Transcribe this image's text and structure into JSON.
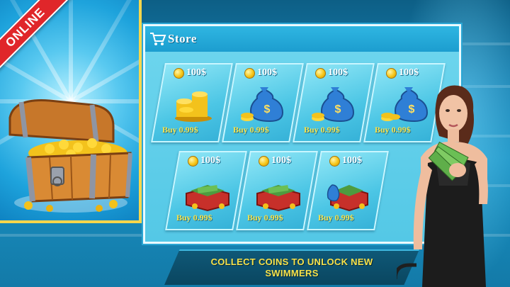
{
  "badge": {
    "label": "ONLINE"
  },
  "store": {
    "title": "Store",
    "items": [
      {
        "amount": "100$",
        "price": "Buy 0.99$",
        "art": "coin-stack"
      },
      {
        "amount": "100$",
        "price": "Buy 0.99$",
        "art": "money-bag"
      },
      {
        "amount": "100$",
        "price": "Buy 0.99$",
        "art": "money-bag"
      },
      {
        "amount": "100$",
        "price": "Buy 0.99$",
        "art": "money-bag"
      },
      {
        "amount": "100$",
        "price": "Buy 0.99$",
        "art": "cash-box"
      },
      {
        "amount": "100$",
        "price": "Buy 0.99$",
        "art": "cash-box"
      },
      {
        "amount": "100$",
        "price": "Buy 0.99$",
        "art": "cash-box-bag"
      }
    ]
  },
  "banner": {
    "line1": "COLLECT COINS TO UNLOCK NEW",
    "line2": "SWIMMERS"
  },
  "colors": {
    "accent": "#f6d64b",
    "ribbon": "#e0262a",
    "price": "#f8e24a"
  }
}
